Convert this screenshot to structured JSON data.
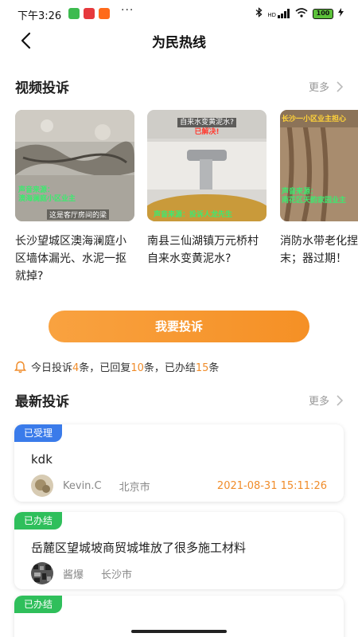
{
  "status_bar": {
    "time": "下午3:26",
    "dots": "···",
    "network": "HD",
    "battery": "100"
  },
  "header": {
    "title": "为民热线"
  },
  "video_section": {
    "title": "视频投诉",
    "more": "更多",
    "videos": [
      {
        "caption": "长沙望城区澳海澜庭小区墙体漏光、水泥一抠就掉?",
        "overlay_top": "",
        "overlay_source_label": "声音来源：",
        "overlay_source": "澳海澜庭小区业主",
        "overlay_bottom": "这是客厅房间的梁"
      },
      {
        "caption": "南县三仙湖镇万元桥村自来水变黄泥水?",
        "overlay_top": "自来水变黄泥水?",
        "overlay_top2": "已解决!",
        "overlay_source_label": "声音来源：",
        "overlay_source": "投诉人龙先生"
      },
      {
        "caption": "消防水带老化捏就成粉末；器过期！",
        "overlay_top": "长沙一小区业主担心",
        "overlay_source_label": "声音来源：",
        "overlay_source": "南花区天韵家园业主"
      }
    ]
  },
  "complain_button": "我要投诉",
  "stats": {
    "prefix": "今日投诉",
    "complaints": "4",
    "mid1": "条，已回复",
    "replied": "10",
    "mid2": "条，已办结",
    "finished": "15",
    "suffix": "条"
  },
  "latest_section": {
    "title": "最新投诉",
    "more": "更多",
    "items": [
      {
        "status": "已受理",
        "status_color": "#3a7bea",
        "title": "kdk",
        "user": "Kevin.C",
        "city": "北京市",
        "time": "2021-08-31 15:11:26"
      },
      {
        "status": "已办结",
        "status_color": "#2fbf5b",
        "title": "岳麓区望城坡商贸城堆放了很多施工材料",
        "user": "酱爆",
        "city": "长沙市",
        "time": ""
      },
      {
        "status": "已办结",
        "status_color": "#2fbf5b",
        "title": "",
        "user": "",
        "city": "",
        "time": ""
      }
    ]
  },
  "colors": {
    "accent_orange": "#f59025",
    "accepted_blue": "#3a7bea",
    "done_green": "#2fbf5b"
  }
}
